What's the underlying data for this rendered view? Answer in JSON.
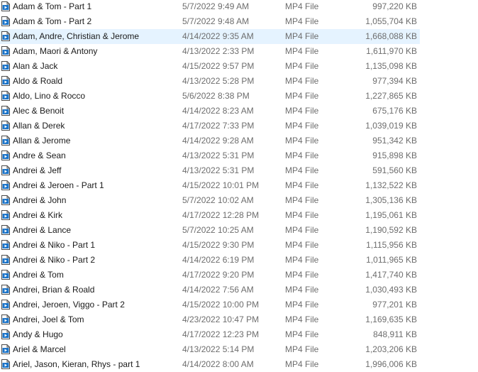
{
  "file_list": {
    "hovered_index": 2,
    "icon": "video-file-icon",
    "colors": {
      "hover_bg": "#e5f3ff",
      "icon_blue": "#1a73c8",
      "secondary_text": "#6d6d6d"
    },
    "rows": [
      {
        "name": "Adam & Tom - Part 1",
        "date": "5/7/2022 9:49 AM",
        "type": "MP4 File",
        "size": "997,220 KB"
      },
      {
        "name": "Adam & Tom - Part 2",
        "date": "5/7/2022 9:48 AM",
        "type": "MP4 File",
        "size": "1,055,704 KB"
      },
      {
        "name": "Adam, Andre, Christian & Jerome",
        "date": "4/14/2022 9:35 AM",
        "type": "MP4 File",
        "size": "1,668,088 KB"
      },
      {
        "name": "Adam, Maori & Antony",
        "date": "4/13/2022 2:33 PM",
        "type": "MP4 File",
        "size": "1,611,970 KB"
      },
      {
        "name": "Alan & Jack",
        "date": "4/15/2022 9:57 PM",
        "type": "MP4 File",
        "size": "1,135,098 KB"
      },
      {
        "name": "Aldo & Roald",
        "date": "4/13/2022 5:28 PM",
        "type": "MP4 File",
        "size": "977,394 KB"
      },
      {
        "name": "Aldo, Lino & Rocco",
        "date": "5/6/2022 8:38 PM",
        "type": "MP4 File",
        "size": "1,227,865 KB"
      },
      {
        "name": "Alec & Benoit",
        "date": "4/14/2022 8:23 AM",
        "type": "MP4 File",
        "size": "675,176 KB"
      },
      {
        "name": "Allan & Derek",
        "date": "4/17/2022 7:33 PM",
        "type": "MP4 File",
        "size": "1,039,019 KB"
      },
      {
        "name": "Allan & Jerome",
        "date": "4/14/2022 9:28 AM",
        "type": "MP4 File",
        "size": "951,342 KB"
      },
      {
        "name": "Andre & Sean",
        "date": "4/13/2022 5:31 PM",
        "type": "MP4 File",
        "size": "915,898 KB"
      },
      {
        "name": "Andrei & Jeff",
        "date": "4/13/2022 5:31 PM",
        "type": "MP4 File",
        "size": "591,560 KB"
      },
      {
        "name": "Andrei & Jeroen - Part 1",
        "date": "4/15/2022 10:01 PM",
        "type": "MP4 File",
        "size": "1,132,522 KB"
      },
      {
        "name": "Andrei & John",
        "date": "5/7/2022 10:02 AM",
        "type": "MP4 File",
        "size": "1,305,136 KB"
      },
      {
        "name": "Andrei & Kirk",
        "date": "4/17/2022 12:28 PM",
        "type": "MP4 File",
        "size": "1,195,061 KB"
      },
      {
        "name": "Andrei & Lance",
        "date": "5/7/2022 10:25 AM",
        "type": "MP4 File",
        "size": "1,190,592 KB"
      },
      {
        "name": "Andrei & Niko - Part 1",
        "date": "4/15/2022 9:30 PM",
        "type": "MP4 File",
        "size": "1,115,956 KB"
      },
      {
        "name": "Andrei & Niko - Part 2",
        "date": "4/14/2022 6:19 PM",
        "type": "MP4 File",
        "size": "1,011,965 KB"
      },
      {
        "name": "Andrei & Tom",
        "date": "4/17/2022 9:20 PM",
        "type": "MP4 File",
        "size": "1,417,740 KB"
      },
      {
        "name": "Andrei, Brian & Roald",
        "date": "4/14/2022 7:56 AM",
        "type": "MP4 File",
        "size": "1,030,493 KB"
      },
      {
        "name": "Andrei, Jeroen, Viggo - Part 2",
        "date": "4/15/2022 10:00 PM",
        "type": "MP4 File",
        "size": "977,201 KB"
      },
      {
        "name": "Andrei, Joel & Tom",
        "date": "4/23/2022 10:47 PM",
        "type": "MP4 File",
        "size": "1,169,635 KB"
      },
      {
        "name": "Andy & Hugo",
        "date": "4/17/2022 12:23 PM",
        "type": "MP4 File",
        "size": "848,911 KB"
      },
      {
        "name": "Ariel & Marcel",
        "date": "4/13/2022 5:14 PM",
        "type": "MP4 File",
        "size": "1,203,206 KB"
      },
      {
        "name": "Ariel, Jason, Kieran, Rhys - part 1",
        "date": "4/14/2022 8:00 AM",
        "type": "MP4 File",
        "size": "1,996,006 KB"
      }
    ]
  }
}
